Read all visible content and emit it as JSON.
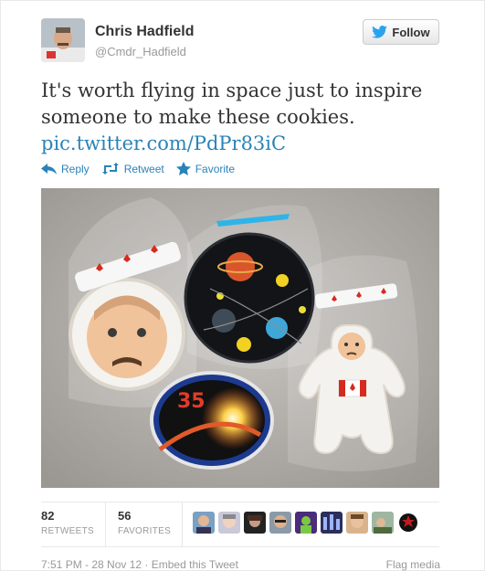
{
  "author": {
    "name": "Chris Hadfield",
    "handle": "@Cmdr_Hadfield"
  },
  "follow_label": "Follow",
  "tweet": {
    "line1": "It's worth flying in space just to inspire",
    "line2": "someone to make these cookies.",
    "link": "pic.twitter.com/PdPr83iC"
  },
  "actions": {
    "reply": "Reply",
    "retweet": "Retweet",
    "favorite": "Favorite"
  },
  "media": {
    "mission_number": "35"
  },
  "stats": {
    "retweets": {
      "count": "82",
      "label": "RETWEETS"
    },
    "favorites": {
      "count": "56",
      "label": "FAVORITES"
    }
  },
  "footer": {
    "timestamp": "7:51 PM - 28 Nov 12",
    "separator": "·",
    "embed": "Embed this Tweet",
    "flag": "Flag media"
  },
  "colors": {
    "link": "#2a83b8",
    "twitter_bird": "#2aa3ef",
    "muted": "#999999"
  }
}
